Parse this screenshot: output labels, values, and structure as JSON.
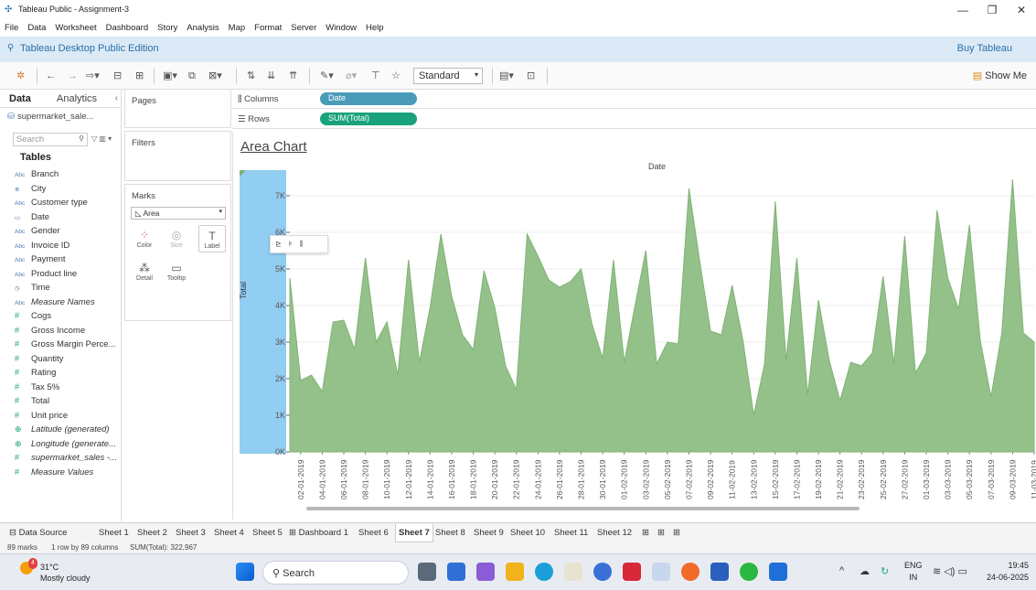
{
  "window": {
    "title": "Tableau Public - Assignment-3",
    "minimize": "—",
    "restore": "❐",
    "close": "✕"
  },
  "menu": [
    "File",
    "Data",
    "Worksheet",
    "Dashboard",
    "Story",
    "Analysis",
    "Map",
    "Format",
    "Server",
    "Window",
    "Help"
  ],
  "edition": {
    "label": "Tableau Desktop Public Edition",
    "buy": "Buy Tableau"
  },
  "toolbar": {
    "fit_mode": "Standard",
    "show_me": "Show Me"
  },
  "data_pane": {
    "tab_data": "Data",
    "tab_analytics": "Analytics",
    "datasource": "supermarket_sale...",
    "search_placeholder": "Search",
    "tables_heading": "Tables",
    "dimensions": [
      {
        "type": "Abc",
        "name": "Branch"
      },
      {
        "type": "⊕",
        "name": "City"
      },
      {
        "type": "Abc",
        "name": "Customer type"
      },
      {
        "type": "▭",
        "name": "Date"
      },
      {
        "type": "Abc",
        "name": "Gender"
      },
      {
        "type": "Abc",
        "name": "Invoice ID"
      },
      {
        "type": "Abc",
        "name": "Payment"
      },
      {
        "type": "Abc",
        "name": "Product line"
      },
      {
        "type": "◷",
        "name": "Time"
      },
      {
        "type": "Abc",
        "name": "Measure Names"
      }
    ],
    "measures": [
      {
        "type": "#",
        "name": "Cogs"
      },
      {
        "type": "#",
        "name": "Gross Income"
      },
      {
        "type": "#",
        "name": "Gross Margin Perce..."
      },
      {
        "type": "#",
        "name": "Quantity"
      },
      {
        "type": "#",
        "name": "Rating"
      },
      {
        "type": "#",
        "name": "Tax 5%"
      },
      {
        "type": "#",
        "name": "Total"
      },
      {
        "type": "#",
        "name": "Unit price"
      },
      {
        "type": "⊕",
        "name": "Latitude (generated)"
      },
      {
        "type": "⊕",
        "name": "Longitude (generate..."
      },
      {
        "type": "#",
        "name": "supermarket_sales -..."
      },
      {
        "type": "#",
        "name": "Measure Values"
      }
    ]
  },
  "cards": {
    "pages": "Pages",
    "filters": "Filters",
    "marks": "Marks",
    "mark_type": "Area",
    "buttons": {
      "color": "Color",
      "size": "Size",
      "label": "Label",
      "detail": "Detail",
      "tooltip": "Tooltip"
    }
  },
  "shelves": {
    "columns_label": "Columns",
    "rows_label": "Rows",
    "columns_pill": "Date",
    "rows_pill": "SUM(Total)",
    "columns_color": "#4a9bb8",
    "rows_color": "#19a27b"
  },
  "chart_data": {
    "type": "area",
    "title": "Area Chart",
    "header": "Date",
    "ylabel": "Total",
    "ylim": [
      0,
      7700
    ],
    "yticks": [
      0,
      1000,
      2000,
      3000,
      4000,
      5000,
      6000,
      7000
    ],
    "ytick_labels": [
      "0K",
      "1K",
      "2K",
      "3K",
      "4K",
      "5K",
      "6K",
      "7K"
    ],
    "color": "#94c18a",
    "x": [
      "01-01-2019",
      "02-01-2019",
      "03-01-2019",
      "04-01-2019",
      "05-01-2019",
      "06-01-2019",
      "07-01-2019",
      "08-01-2019",
      "09-01-2019",
      "10-01-2019",
      "11-01-2019",
      "12-01-2019",
      "13-01-2019",
      "14-01-2019",
      "15-01-2019",
      "16-01-2019",
      "17-01-2019",
      "18-01-2019",
      "19-01-2019",
      "20-01-2019",
      "21-01-2019",
      "22-01-2019",
      "23-01-2019",
      "24-01-2019",
      "25-01-2019",
      "26-01-2019",
      "27-01-2019",
      "28-01-2019",
      "29-01-2019",
      "30-01-2019",
      "31-01-2019",
      "01-02-2019",
      "02-02-2019",
      "03-02-2019",
      "04-02-2019",
      "05-02-2019",
      "06-02-2019",
      "07-02-2019",
      "08-02-2019",
      "09-02-2019",
      "10-02-2019",
      "11-02-2019",
      "12-02-2019",
      "13-02-2019",
      "14-02-2019",
      "15-02-2019",
      "16-02-2019",
      "17-02-2019",
      "18-02-2019",
      "19-02-2019",
      "20-02-2019",
      "21-02-2019",
      "22-02-2019",
      "23-02-2019",
      "24-02-2019",
      "25-02-2019",
      "26-02-2019",
      "27-02-2019",
      "28-02-2019",
      "01-03-2019",
      "02-03-2019",
      "03-03-2019",
      "04-03-2019",
      "05-03-2019",
      "06-03-2019",
      "07-03-2019",
      "08-03-2019",
      "09-03-2019",
      "10-03-2019",
      "11-03-2019"
    ],
    "values": [
      4750,
      1950,
      2100,
      1650,
      3550,
      3600,
      2800,
      5300,
      3000,
      3550,
      2100,
      5250,
      2450,
      3950,
      5950,
      4250,
      3200,
      2800,
      4950,
      3950,
      2350,
      1700,
      5950,
      5350,
      4700,
      4500,
      4650,
      5000,
      3500,
      2550,
      5250,
      2450,
      4000,
      5500,
      2400,
      3000,
      2950,
      7200,
      5200,
      3300,
      3200,
      4550,
      3050,
      1000,
      2400,
      6850,
      2500,
      5300,
      1550,
      4150,
      2500,
      1400,
      2450,
      2350,
      2700,
      4800,
      2400,
      5900,
      2150,
      2700,
      6600,
      4750,
      3900,
      6200,
      3050,
      1500,
      3250,
      7450,
      3250,
      3000
    ],
    "xtick_labels": [
      "02-01-2019",
      "04-01-2019",
      "06-01-2019",
      "08-01-2019",
      "10-01-2019",
      "12-01-2019",
      "14-01-2019",
      "16-01-2019",
      "18-01-2019",
      "20-01-2019",
      "22-01-2019",
      "24-01-2019",
      "26-01-2019",
      "28-01-2019",
      "30-01-2019",
      "01-02-2019",
      "03-02-2019",
      "05-02-2019",
      "07-02-2019",
      "09-02-2019",
      "11-02-2019",
      "13-02-2019",
      "15-02-2019",
      "17-02-2019",
      "19-02-2019",
      "21-02-2019",
      "23-02-2019",
      "25-02-2019",
      "27-02-2019",
      "01-03-2019",
      "03-03-2019",
      "05-03-2019",
      "07-03-2019",
      "09-03-2019",
      "11-03-2019"
    ]
  },
  "sheet_tabs": [
    "Sheet 1",
    "Sheet 2",
    "Sheet 3",
    "Sheet 4",
    "Sheet 5",
    "Dashboard 1",
    "Sheet 6",
    "Sheet 7",
    "Sheet 8",
    "Sheet 9",
    "Sheet 10",
    "Sheet 11",
    "Sheet 12"
  ],
  "active_sheet": "Sheet 7",
  "data_source_tab": "Data Source",
  "status": {
    "marks": "89 marks",
    "rows": "1 row by 89 columns",
    "sum": "SUM(Total): 322,967"
  },
  "taskbar": {
    "temp": "31°C",
    "weather": "Mostly cloudy",
    "search": "Search",
    "lang1": "ENG",
    "lang2": "IN",
    "time": "19:45",
    "date": "24-06-2025",
    "badge": "4"
  }
}
